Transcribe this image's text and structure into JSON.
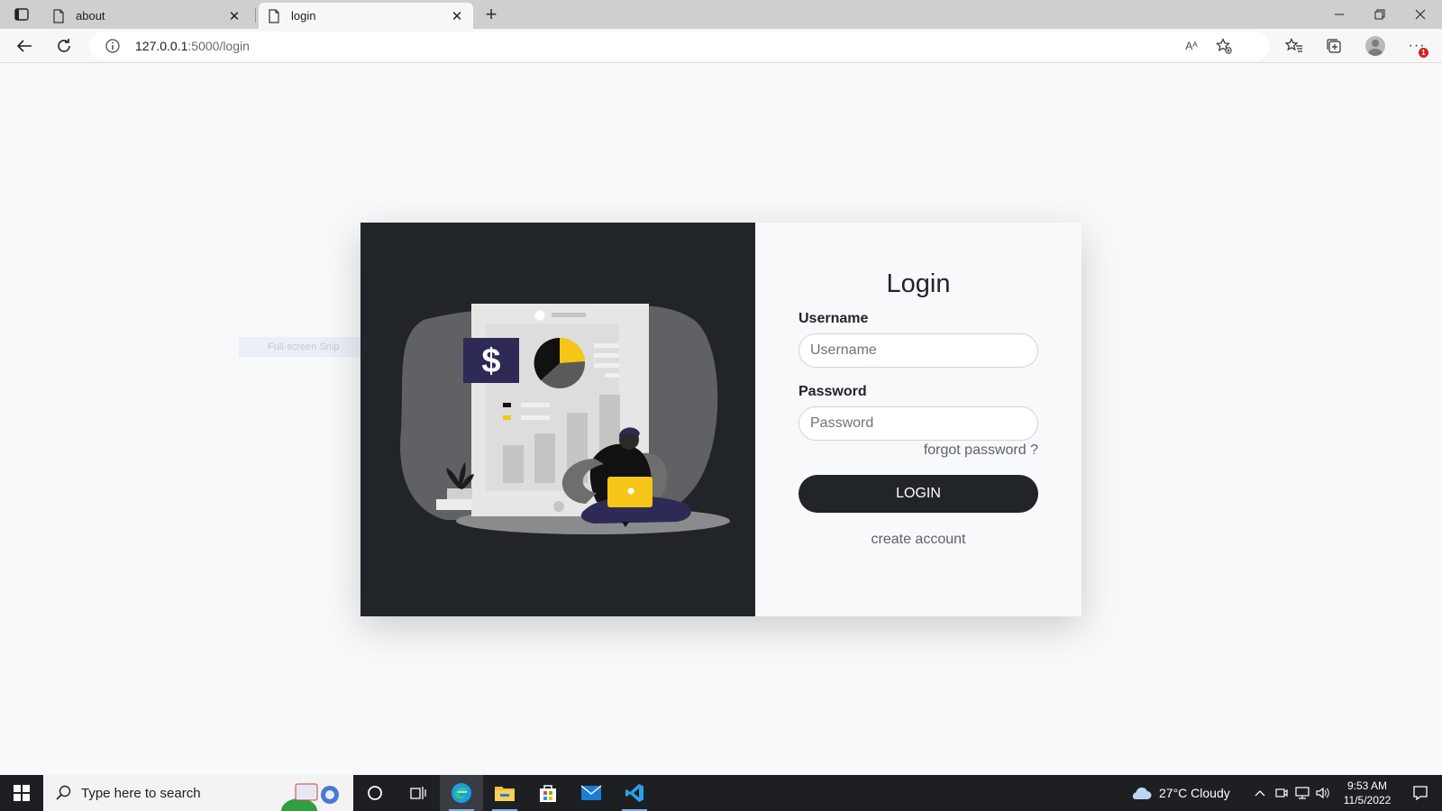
{
  "browser": {
    "tabs": [
      {
        "title": "about",
        "active": false
      },
      {
        "title": "login",
        "active": true
      }
    ],
    "new_tab_symbol": "+",
    "address": {
      "host": "127.0.0.1",
      "path": ":5000/login"
    },
    "read_aloud_label": "Aᴬ"
  },
  "snip_ghost": "Full-screen Snip",
  "login": {
    "title": "Login",
    "username_label": "Username",
    "username_placeholder": "Username",
    "password_label": "Password",
    "password_placeholder": "Password",
    "forgot": "forgot password ?",
    "login_button": "LOGIN",
    "create_account": "create account"
  },
  "illustration": {
    "colors": {
      "panel": "#212529",
      "blob": "#5f6164",
      "doc": "#e6e6e6",
      "accent": "#f5c518",
      "navy": "#2d2b55"
    },
    "dollar_symbol": "$"
  },
  "notification_badge": "1",
  "taskbar": {
    "search_placeholder": "Type here to search",
    "weather": "27°C  Cloudy",
    "time": "9:53 AM",
    "date": "11/5/2022"
  }
}
